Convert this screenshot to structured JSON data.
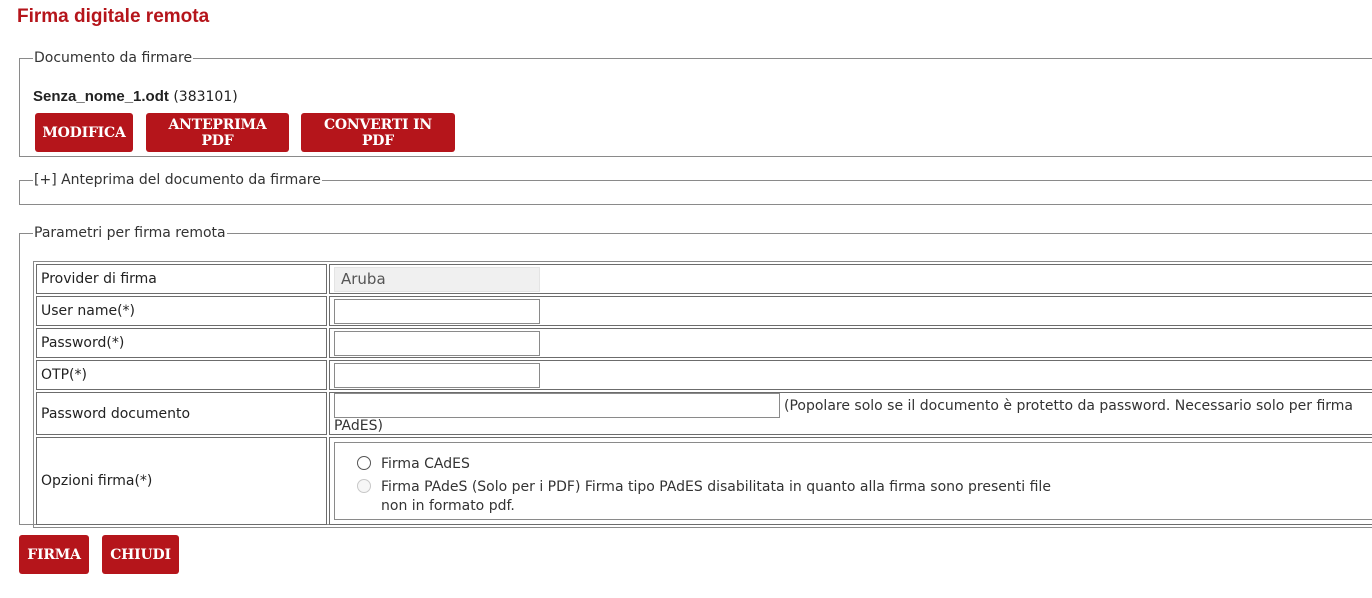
{
  "page": {
    "title": "Firma digitale remota"
  },
  "document_section": {
    "legend": "Documento da firmare",
    "file_name": "Senza_nome_1.odt",
    "file_id": "(383101)",
    "buttons": {
      "modifica": "MODIFICA",
      "anteprima_pdf": "ANTEPRIMA PDF",
      "converti_pdf": "CONVERTI IN PDF"
    }
  },
  "preview_section": {
    "legend": "[+] Anteprima del documento da firmare"
  },
  "params_section": {
    "legend": "Parametri per firma remota",
    "rows": {
      "provider": {
        "label": "Provider di firma",
        "value": "Aruba"
      },
      "username": {
        "label": "User name(*)",
        "value": ""
      },
      "password": {
        "label": "Password(*)",
        "value": ""
      },
      "otp": {
        "label": "OTP(*)",
        "value": ""
      },
      "doc_password": {
        "label": "Password documento",
        "value": "",
        "hint": "(Popolare solo se il documento è protetto da password. Necessario solo per firma PAdES)"
      },
      "options": {
        "label": "Opzioni firma(*)",
        "cades": "Firma CAdES",
        "pades": "Firma PAdeS (Solo per i PDF) Firma tipo PAdES disabilitata in quanto alla firma sono presenti file non in formato pdf."
      }
    }
  },
  "footer": {
    "firma": "FIRMA",
    "chiudi": "CHIUDI"
  },
  "colors": {
    "accent": "#b5151b",
    "border": "#8a8a8a"
  }
}
